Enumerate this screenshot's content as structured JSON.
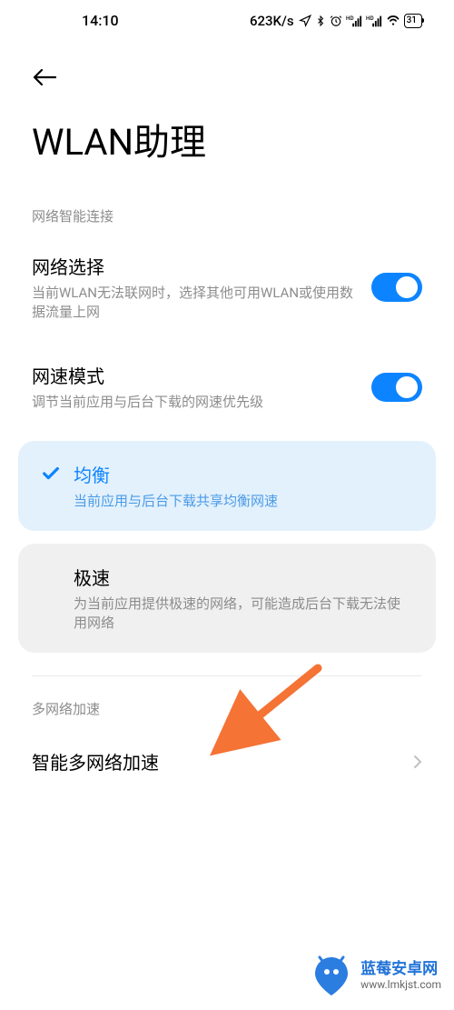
{
  "statusBar": {
    "time": "14:10",
    "speed": "623K/s",
    "battery": "31"
  },
  "page": {
    "title": "WLAN助理"
  },
  "section1": {
    "label": "网络智能连接",
    "items": [
      {
        "title": "网络选择",
        "desc": "当前WLAN无法联网时，选择其他可用WLAN或使用数据流量上网",
        "toggle": true
      },
      {
        "title": "网速模式",
        "desc": "调节当前应用与后台下载的网速优先级",
        "toggle": true
      }
    ]
  },
  "speedOptions": [
    {
      "title": "均衡",
      "desc": "当前应用与后台下载共享均衡网速",
      "selected": true
    },
    {
      "title": "极速",
      "desc": "为当前应用提供极速的网络，可能造成后台下载无法使用网络",
      "selected": false
    }
  ],
  "section2": {
    "label": "多网络加速",
    "items": [
      {
        "title": "智能多网络加速"
      }
    ]
  },
  "watermark": {
    "name": "蓝莓安卓网",
    "url": "www.lmkjst.com"
  }
}
